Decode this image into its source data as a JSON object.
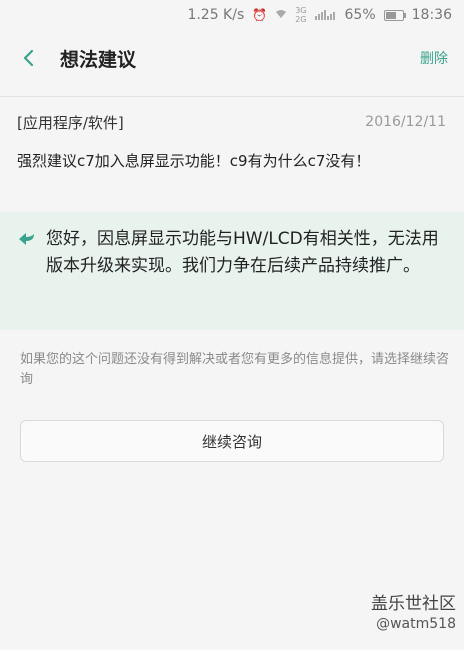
{
  "status_bar": {
    "speed": "1.25 K/s",
    "network_top": "3G",
    "network_bottom": "2G",
    "battery": "65%",
    "time": "18:36"
  },
  "app_bar": {
    "title": "想法建议",
    "delete_label": "删除"
  },
  "feedback": {
    "category": "[应用程序/软件]",
    "date": "2016/12/11",
    "question": "强烈建议c7加入息屏显示功能！c9有为什么c7没有！"
  },
  "reply": {
    "text": "您好，因息屏显示功能与HW/LCD有相关性，无法用版本升级来实现。我们力争在后续产品持续推广。"
  },
  "hint": "如果您的这个问题还没有得到解决或者您有更多的信息提供，请选择继续咨询",
  "continue_label": "继续咨询",
  "watermark": {
    "title": "盖乐世社区",
    "handle": "@watm518"
  },
  "colors": {
    "accent": "#3aa38c",
    "reply_bg": "#e8f3ee"
  }
}
